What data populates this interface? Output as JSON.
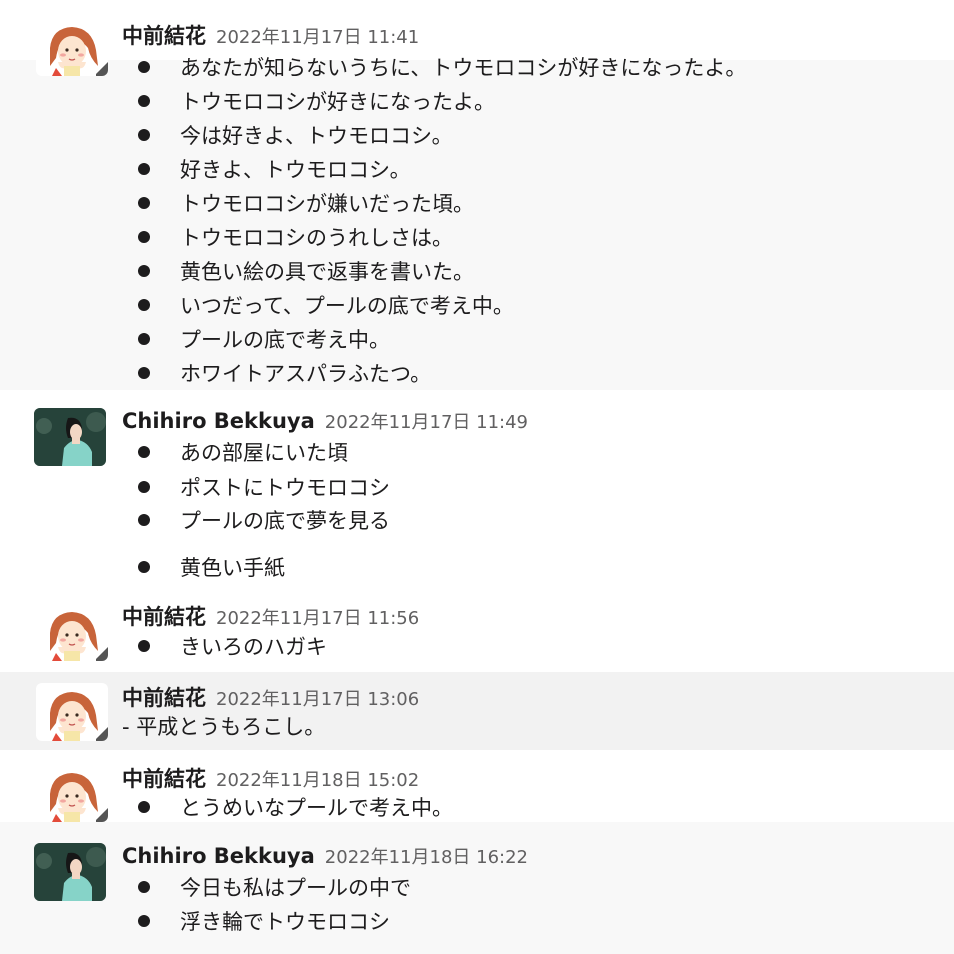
{
  "messages": [
    {
      "author": "中前結花",
      "timestamp": "2022年11月17日 11:41",
      "avatar": "girl-avatar",
      "items": [
        "あなたが知らないうちに、トウモロコシが好きになったよ。",
        "トウモロコシが好きになったよ。",
        "今は好きよ、トウモロコシ。",
        "好きよ、トウモロコシ。",
        "トウモロコシが嫌いだった頃。",
        "トウモロコシのうれしさは。",
        "黄色い絵の具で返事を書いた。",
        "いつだって、プールの底で考え中。",
        "プールの底で考え中。",
        "ホワイトアスパラふたつ。"
      ]
    },
    {
      "author": "Chihiro Bekkuya",
      "timestamp": "2022年11月17日 11:49",
      "avatar": "man-avatar",
      "items": [
        "あの部屋にいた頃",
        "ポストにトウモロコシ",
        "プールの底で夢を見る",
        "黄色い手紙"
      ]
    },
    {
      "author": "中前結花",
      "timestamp": "2022年11月17日 11:56",
      "avatar": "girl-avatar",
      "items": [
        "きいろのハガキ"
      ]
    },
    {
      "author": "中前結花",
      "timestamp": "2022年11月17日 13:06",
      "avatar": "girl-avatar",
      "text": "- 平成とうもろこし。"
    },
    {
      "author": "中前結花",
      "timestamp": "2022年11月18日 15:02",
      "avatar": "girl-avatar",
      "items": [
        "とうめいなプールで考え中。"
      ]
    },
    {
      "author": "Chihiro Bekkuya",
      "timestamp": "2022年11月18日 16:22",
      "avatar": "man-avatar",
      "items": [
        "今日も私はプールの中で",
        "浮き輪でトウモロコシ"
      ]
    }
  ],
  "colors": {
    "text": "#1d1c1d",
    "timestamp": "#616061",
    "row_light": "#f8f8f8",
    "row_hover": "#f2f2f2"
  }
}
